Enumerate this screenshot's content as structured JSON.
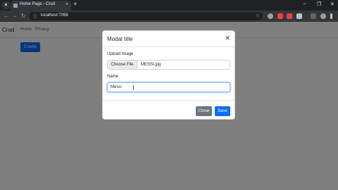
{
  "browser": {
    "tab_title": "Home Page - Crud",
    "tab_close": "×",
    "new_tab": "+",
    "tab_search": "▾",
    "window_controls": {
      "minimize": "–",
      "maximize": "❐",
      "close": "✕"
    },
    "nav": {
      "back": "←",
      "forward": "→",
      "reload": "↻"
    },
    "url": "localhost:7098",
    "info_icon": "ⓘ",
    "star_icon": "☆"
  },
  "site": {
    "brand": "Crud",
    "nav_links": [
      "Home",
      "Privacy"
    ],
    "create_button": "Create"
  },
  "modal": {
    "title": "Modal title",
    "close_icon": "✕",
    "upload_label": "Upload Image",
    "file_button": "Choose File",
    "file_name": "MESSI.jpg",
    "name_label": "Name",
    "name_value": "Messi",
    "close_button": "Close",
    "save_button": "Save"
  },
  "colors": {
    "primary": "#0d6efd",
    "secondary": "#6c757d",
    "extension_colors": [
      "#ea4335",
      "#ea4335",
      "#e8eaed"
    ]
  }
}
